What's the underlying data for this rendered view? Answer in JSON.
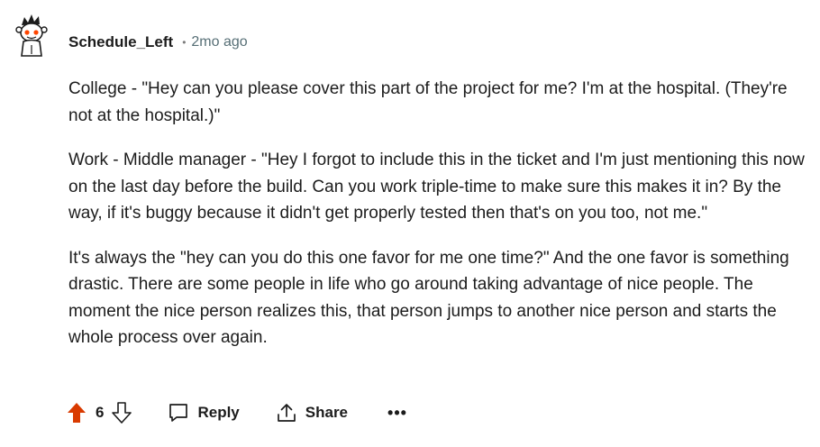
{
  "comment": {
    "author": "Schedule_Left",
    "separator": "•",
    "timestamp": "2mo ago",
    "paragraphs": [
      "College - \"Hey can you please cover this part of the project for me? I'm at the hospital. (They're not at the hospital.)\"",
      "Work - Middle manager - \"Hey I forgot to include this in the ticket and I'm just mentioning this now on the last day before the build. Can you work triple-time to make sure this makes it in? By the way, if it's buggy because it didn't get properly tested then that's on you too, not me.\"",
      "It's always the \"hey can you do this one favor for me one time?\" And the one favor is something drastic. There are some people in life who go around taking advantage of nice people. The moment the nice person realizes this, that person jumps to another nice person and starts the whole process over again."
    ]
  },
  "actions": {
    "score": "6",
    "reply_label": "Reply",
    "share_label": "Share",
    "more_label": "•••"
  },
  "colors": {
    "upvote_active": "#d93a00",
    "meta_text": "#576f76"
  }
}
